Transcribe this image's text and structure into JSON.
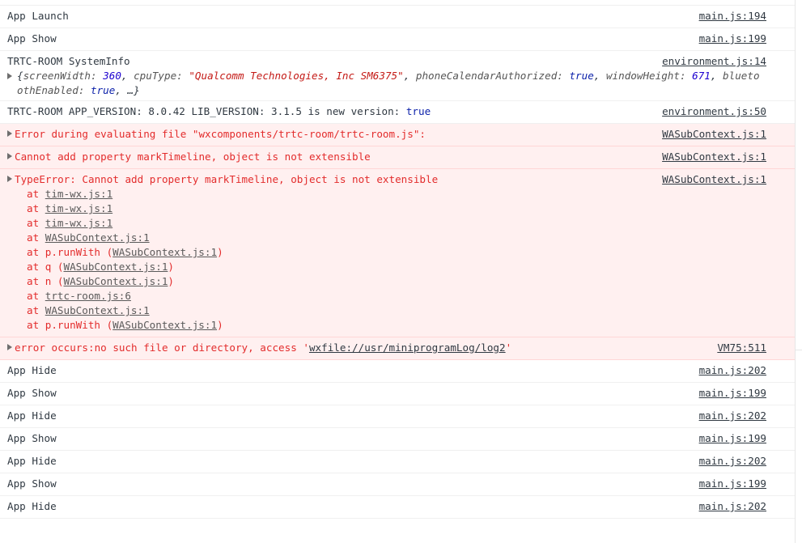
{
  "rows": [
    {
      "text": "App Launch",
      "src": "main.js:194"
    },
    {
      "text": "App Show",
      "src": "main.js:199"
    }
  ],
  "systeminfo": {
    "title": "TRTC-ROOM SystemInfo",
    "src": "environment.js:14",
    "obj": {
      "open": "{",
      "k1": "screenWidth: ",
      "v1": "360",
      "sep1": ", ",
      "k2": "cpuType: ",
      "v2": "\"Qualcomm Technologies, Inc SM6375\"",
      "sep2": ", ",
      "k3": "phoneCalendarAuthorized: ",
      "v3": "true",
      "sep3": ", ",
      "k4": "windowHeight: ",
      "v4": "671",
      "sep4": ", ",
      "k5": "bluetoothEnabled: ",
      "v5": "true",
      "tail": ", …}"
    }
  },
  "version": {
    "text": "TRTC-ROOM APP_VERSION: 8.0.42  LIB_VERSION: 3.1.5  is new version: ",
    "value": "true",
    "src": "environment.js:50"
  },
  "errors": [
    {
      "text": "Error during evaluating file \"wxcomponents/trtc-room/trtc-room.js\":",
      "src": "WASubContext.js:1"
    },
    {
      "text": "Cannot add property markTimeline, object is not extensible",
      "src": "WASubContext.js:1"
    }
  ],
  "typeerror": {
    "text": "TypeError: Cannot add property markTimeline, object is not extensible",
    "src": "WASubContext.js:1",
    "stack": [
      {
        "pre": "at ",
        "link": "tim-wx.js:1",
        "post": ""
      },
      {
        "pre": "at ",
        "link": "tim-wx.js:1",
        "post": ""
      },
      {
        "pre": "at ",
        "link": "tim-wx.js:1",
        "post": ""
      },
      {
        "pre": "at ",
        "link": "WASubContext.js:1",
        "post": ""
      },
      {
        "pre": "at p.runWith (",
        "link": "WASubContext.js:1",
        "post": ")"
      },
      {
        "pre": "at q (",
        "link": "WASubContext.js:1",
        "post": ")"
      },
      {
        "pre": "at n (",
        "link": "WASubContext.js:1",
        "post": ")"
      },
      {
        "pre": "at ",
        "link": "trtc-room.js:6",
        "post": ""
      },
      {
        "pre": "at ",
        "link": "WASubContext.js:1",
        "post": ""
      },
      {
        "pre": "at p.runWith (",
        "link": "WASubContext.js:1",
        "post": ")"
      }
    ]
  },
  "fileerror": {
    "pre": "error occurs:no such file or directory, access '",
    "link": "wxfile://usr/miniprogramLog/log2",
    "post": "'",
    "src": "VM75:511"
  },
  "tail_rows": [
    {
      "text": "App Hide",
      "src": "main.js:202"
    },
    {
      "text": "App Show",
      "src": "main.js:199"
    },
    {
      "text": "App Hide",
      "src": "main.js:202"
    },
    {
      "text": "App Show",
      "src": "main.js:199"
    },
    {
      "text": "App Hide",
      "src": "main.js:202"
    },
    {
      "text": "App Show",
      "src": "main.js:199"
    },
    {
      "text": "App Hide",
      "src": "main.js:202"
    }
  ],
  "colors": {
    "error_bg": "#fff0f0",
    "error_text": "#e32c2c",
    "number": "#1c00cf",
    "string": "#c41a16",
    "boolean": "#0d22aa"
  }
}
